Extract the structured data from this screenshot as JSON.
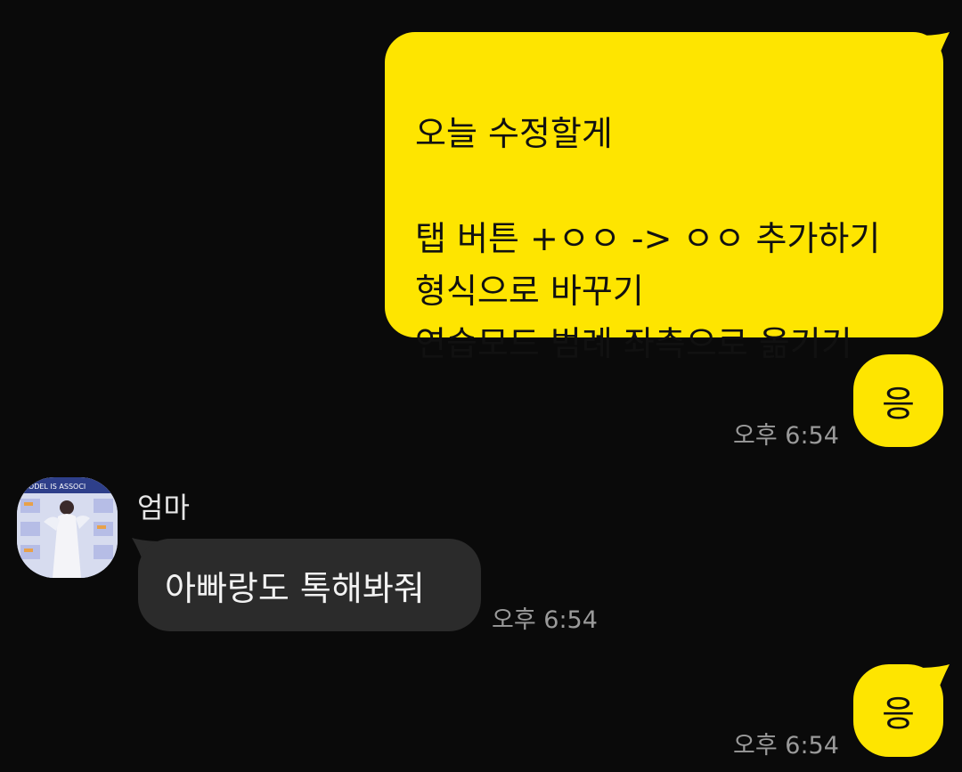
{
  "messages": [
    {
      "direction": "outgoing",
      "text": "오늘 수정할게\n\n탭 버튼 +ㅇㅇ -> ㅇㅇ 추가하기\n형식으로 바꾸기\n연습모드 범례 좌측으로 옮기기"
    },
    {
      "direction": "outgoing",
      "text": "응",
      "time": "오후 6:54"
    },
    {
      "direction": "incoming",
      "sender": "엄마",
      "text": "아빠랑도 톡해봐줘",
      "time": "오후 6:54"
    },
    {
      "direction": "outgoing",
      "text": "응",
      "time": "오후 6:54"
    }
  ],
  "avatar_photo_text": "MODEL IS ASSOCI",
  "colors": {
    "background": "#0a0a0a",
    "outgoing_bubble": "#fee500",
    "incoming_bubble": "#2b2b2b",
    "time_text": "#9a9a9a"
  }
}
